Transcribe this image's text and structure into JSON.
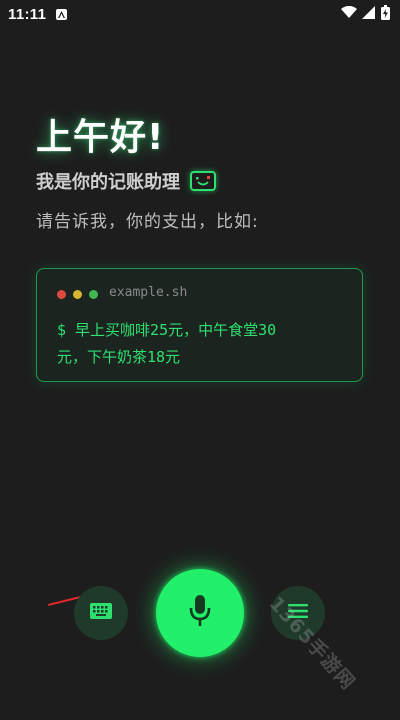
{
  "status_bar": {
    "time": "11:11",
    "icons": [
      "notification-a-icon",
      "wifi-icon",
      "signal-icon",
      "battery-charging-icon"
    ]
  },
  "greeting": "上午好!",
  "assistant_title": "我是你的记账助理",
  "instruction": "请告诉我，你的支出，比如:",
  "example": {
    "filename": "example.sh",
    "command_line1": "$ 早上买咖啡25元，中午食堂30",
    "command_line2": "元，下午奶茶18元",
    "dot_colors": [
      "#e0483e",
      "#d6b631",
      "#3fb94f"
    ]
  },
  "controls": {
    "left_button": "keyboard-icon",
    "center_button": "microphone-icon",
    "right_button": "menu-icon"
  },
  "watermark": "1365手游网",
  "colors": {
    "accent": "#22f06a",
    "background": "#1d1d1d"
  }
}
